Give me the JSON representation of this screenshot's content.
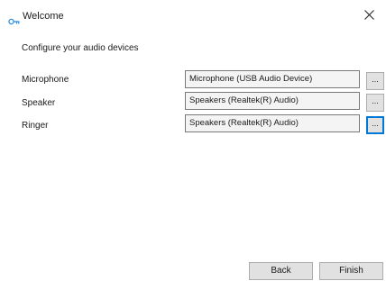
{
  "window": {
    "title": "Welcome",
    "icon": "key-icon",
    "accent_color": "#0078d7"
  },
  "content": {
    "heading": "Configure your audio devices",
    "rows": [
      {
        "label": "Microphone",
        "value": "Microphone (USB Audio Device)",
        "browse_label": "..."
      },
      {
        "label": "Speaker",
        "value": "Speakers (Realtek(R) Audio)",
        "browse_label": "..."
      },
      {
        "label": "Ringer",
        "value": "Speakers (Realtek(R) Audio)",
        "browse_label": "..."
      }
    ]
  },
  "footer": {
    "back_label": "Back",
    "finish_label": "Finish"
  }
}
